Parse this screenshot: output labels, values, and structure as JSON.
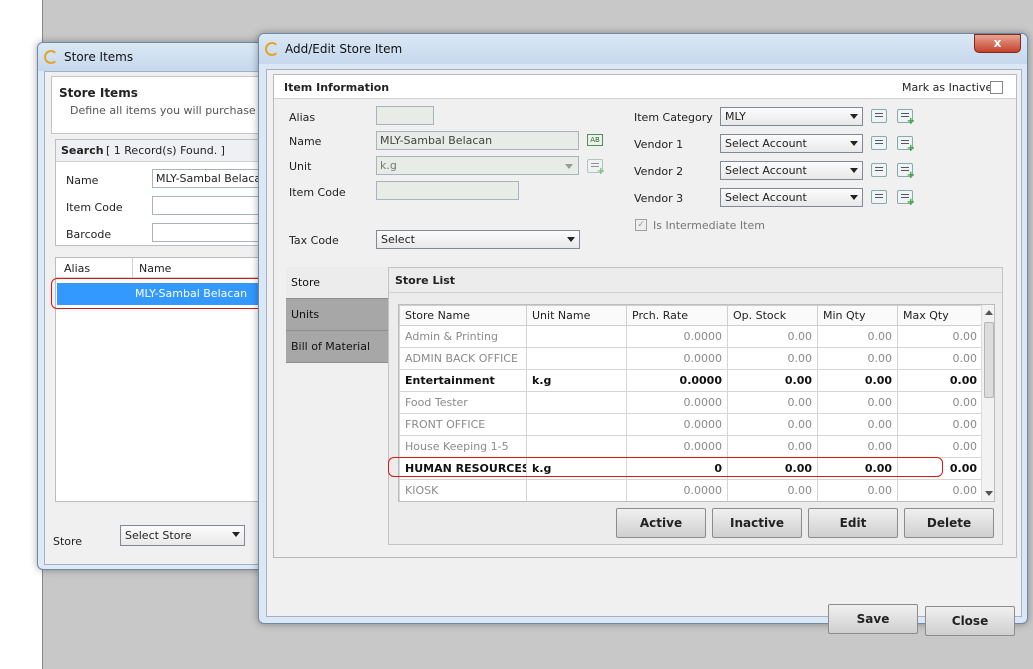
{
  "colors": {
    "highlight": "#e01515",
    "selection": "#3399ff",
    "titlebar": "#c5d8ec"
  },
  "store_items": {
    "window_title": "Store Items",
    "heading": "Store Items",
    "description": "Define all items you will purchase from y",
    "search_label": "Search",
    "records_found": "[ 1 Record(s) Found. ]",
    "fields": {
      "name_label": "Name",
      "name_value": "MLY-Sambal Belacan",
      "item_code_label": "Item Code",
      "item_code_value": "",
      "barcode_label": "Barcode",
      "barcode_value": ""
    },
    "list_headers": {
      "alias": "Alias",
      "name": "Name"
    },
    "list_rows": [
      {
        "alias": "",
        "name": "MLY-Sambal Belacan"
      }
    ],
    "store_label": "Store",
    "store_select": "Select Store"
  },
  "dialog": {
    "title": "Add/Edit Store Item",
    "close_glyph": "x",
    "item_info": "Item Information",
    "mark_inactive": "Mark as Inactive",
    "alias_label": "Alias",
    "alias_value": "",
    "name_label": "Name",
    "name_value": "MLY-Sambal Belacan",
    "unit_label": "Unit",
    "unit_value": "k.g",
    "item_code_label": "Item Code",
    "item_code_value": "",
    "tax_code_label": "Tax Code",
    "tax_code_value": "Select",
    "item_category_label": "Item Category",
    "item_category_value": "MLY",
    "vendor1_label": "Vendor 1",
    "vendor1_value": "Select Account",
    "vendor2_label": "Vendor 2",
    "vendor2_value": "Select Account",
    "vendor3_label": "Vendor 3",
    "vendor3_value": "Select Account",
    "intermediate_label": "Is Intermediate Item",
    "ab_badge": "AB",
    "tabs": [
      "Store",
      "Units",
      "Bill of Material"
    ],
    "store_list_title": "Store List",
    "columns": [
      "Store Name",
      "Unit Name",
      "Prch. Rate",
      "Op. Stock",
      "Min Qty",
      "Max Qty"
    ],
    "rows": [
      {
        "store": "Admin & Printing",
        "unit": "",
        "rate": "0.0000",
        "op": "0.00",
        "min": "0.00",
        "max": "0.00",
        "style": "dim"
      },
      {
        "store": "ADMIN BACK OFFICE",
        "unit": "",
        "rate": "0.0000",
        "op": "0.00",
        "min": "0.00",
        "max": "0.00",
        "style": "dim"
      },
      {
        "store": "Entertainment",
        "unit": "k.g",
        "rate": "0.0000",
        "op": "0.00",
        "min": "0.00",
        "max": "0.00",
        "style": "b"
      },
      {
        "store": "Food Tester",
        "unit": "",
        "rate": "0.0000",
        "op": "0.00",
        "min": "0.00",
        "max": "0.00",
        "style": "dim"
      },
      {
        "store": "FRONT OFFICE",
        "unit": "",
        "rate": "0.0000",
        "op": "0.00",
        "min": "0.00",
        "max": "0.00",
        "style": "dim"
      },
      {
        "store": "House Keeping 1-5",
        "unit": "",
        "rate": "0.0000",
        "op": "0.00",
        "min": "0.00",
        "max": "0.00",
        "style": "dim"
      },
      {
        "store": "HUMAN RESOURCES...",
        "unit": "k.g",
        "rate": "0",
        "op": "0.00",
        "min": "0.00",
        "max": "0.00",
        "style": "b"
      },
      {
        "store": "KIOSK",
        "unit": "",
        "rate": "0.0000",
        "op": "0.00",
        "min": "0.00",
        "max": "0.00",
        "style": "dim"
      }
    ],
    "buttons": {
      "active": "Active",
      "inactive": "Inactive",
      "edit": "Edit",
      "delete": "Delete",
      "save": "Save",
      "close": "Close"
    }
  }
}
